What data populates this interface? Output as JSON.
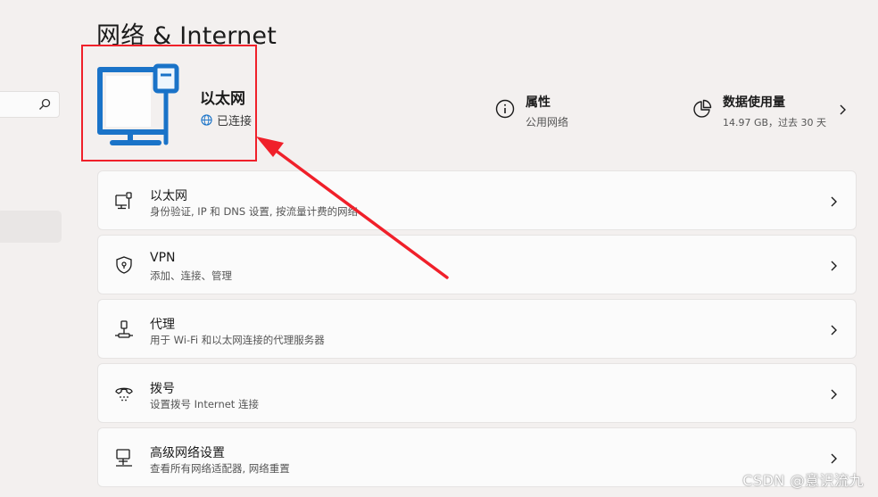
{
  "page": {
    "title": "网络 & Internet"
  },
  "sidebar": {
    "search_icon": "search-icon"
  },
  "hero": {
    "name": "以太网",
    "status": "已连接",
    "icon": "ethernet-monitor-icon"
  },
  "properties": {
    "title": "属性",
    "subtitle": "公用网络"
  },
  "data_usage": {
    "title": "数据使用量",
    "subtitle": "14.97 GB，过去 30 天"
  },
  "cards": [
    {
      "title": "以太网",
      "subtitle": "身份验证, IP 和 DNS 设置, 按流量计费的网络",
      "icon": "ethernet-icon"
    },
    {
      "title": "VPN",
      "subtitle": "添加、连接、管理",
      "icon": "vpn-shield-icon"
    },
    {
      "title": "代理",
      "subtitle": "用于 Wi-Fi 和以太网连接的代理服务器",
      "icon": "proxy-icon"
    },
    {
      "title": "拨号",
      "subtitle": "设置拨号 Internet 连接",
      "icon": "dialup-icon"
    },
    {
      "title": "高级网络设置",
      "subtitle": "查看所有网络适配器, 网络重置",
      "icon": "advanced-network-icon"
    }
  ],
  "annotation": {
    "color": "#f0202a"
  },
  "watermark": "CSDN @意识流九",
  "colors": {
    "accent": "#1a73c8",
    "background": "#f3f0ef"
  }
}
